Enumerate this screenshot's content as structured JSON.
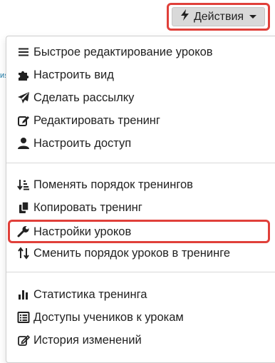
{
  "background": {
    "fragment_text": "ия"
  },
  "actions": {
    "label": "Действия",
    "icon": "bolt-icon",
    "highlighted": true
  },
  "menu": {
    "groups": [
      {
        "items": [
          {
            "label": "Быстрое редактирование уроков",
            "icon": "list-icon"
          },
          {
            "label": "Настроить вид",
            "icon": "puzzle-icon"
          },
          {
            "label": "Сделать рассылку",
            "icon": "paper-plane-icon"
          },
          {
            "label": "Редактировать тренинг",
            "icon": "edit-icon"
          },
          {
            "label": "Настроить доступ",
            "icon": "user-icon"
          }
        ]
      },
      {
        "items": [
          {
            "label": "Поменять порядок тренингов",
            "icon": "sort-amount-icon"
          },
          {
            "label": "Копировать тренинг",
            "icon": "copy-icon"
          },
          {
            "label": "Настройки уроков",
            "icon": "wrench-icon",
            "highlighted": true
          },
          {
            "label": "Сменить порядок уроков в тренинге",
            "icon": "sort-icon"
          }
        ]
      },
      {
        "items": [
          {
            "label": "Статистика тренинга",
            "icon": "bar-chart-icon"
          },
          {
            "label": "Доступы учеников к урокам",
            "icon": "table-list-icon"
          },
          {
            "label": "История изменений",
            "icon": "edit-history-icon"
          }
        ]
      }
    ]
  },
  "colors": {
    "highlight": "#e0403a",
    "button_bg": "#d9d9d9",
    "text": "#222222"
  }
}
